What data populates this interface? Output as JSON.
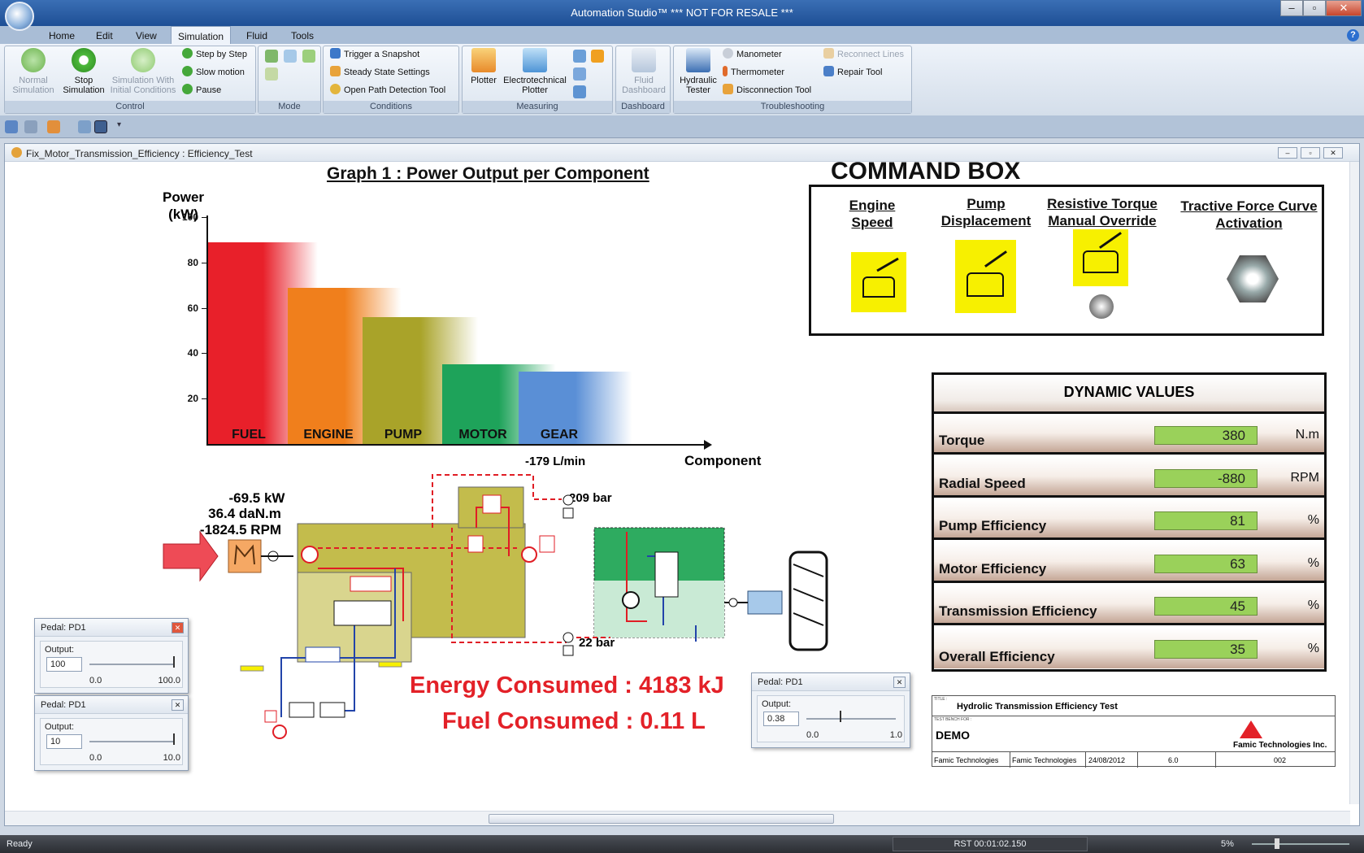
{
  "window": {
    "title": "Automation Studio™  *** NOT FOR RESALE ***"
  },
  "tabs": [
    {
      "label": "Home"
    },
    {
      "label": "Edit"
    },
    {
      "label": "View"
    },
    {
      "label": "Simulation"
    },
    {
      "label": "Fluid"
    },
    {
      "label": "Tools"
    }
  ],
  "ribbon": {
    "control": {
      "caption": "Control",
      "normal_sim": "Normal\nSimulation",
      "stop_sim": "Stop\nSimulation",
      "sim_initial": "Simulation With\nInitial Conditions",
      "step": "Step by Step",
      "slow": "Slow motion",
      "pause": "Pause"
    },
    "mode": {
      "caption": "Mode"
    },
    "conditions": {
      "caption": "Conditions",
      "snapshot": "Trigger a Snapshot",
      "steady": "Steady State Settings",
      "openpath": "Open Path Detection Tool"
    },
    "measuring": {
      "caption": "Measuring",
      "plotter": "Plotter",
      "electro": "Electrotechnical\nPlotter"
    },
    "dashboard": {
      "caption": "Dashboard",
      "fluid": "Fluid\nDashboard"
    },
    "troubleshooting": {
      "caption": "Troubleshooting",
      "hydraulic": "Hydraulic\nTester",
      "manometer": "Manometer",
      "thermometer": "Thermometer",
      "disconnection": "Disconnection Tool",
      "reconnect": "Reconnect Lines",
      "repair": "Repair Tool"
    }
  },
  "document": {
    "title": "Fix_Motor_Transmission_Efficiency : Efficiency_Test"
  },
  "chart_data": {
    "type": "bar",
    "title": "Graph 1 : Power Output per Component",
    "ylabel": "Power\n(kW)",
    "xlabel": "Component",
    "ylim": [
      0,
      100
    ],
    "yticks": [
      20,
      40,
      60,
      80,
      100
    ],
    "categories": [
      "FUEL",
      "ENGINE",
      "PUMP",
      "MOTOR",
      "GEAR"
    ],
    "values": [
      89,
      69,
      56,
      35,
      32
    ],
    "colors": [
      "#e8202a",
      "#f07f1c",
      "#a9a329",
      "#1ea35a",
      "#5a8fd6"
    ]
  },
  "command_box": {
    "title": "COMMAND BOX",
    "engine_speed": "Engine\nSpeed",
    "pump_displacement": "Pump\nDisplacement",
    "resistive_torque": "Resistive Torque\nManual Override",
    "tractive_force": "Tractive Force Curve\nActivation"
  },
  "dynamic_values": {
    "title": "DYNAMIC VALUES",
    "rows": [
      {
        "label": "Torque",
        "value": "380",
        "unit": "N.m"
      },
      {
        "label": "Radial Speed",
        "value": "-880",
        "unit": "RPM"
      },
      {
        "label": "Pump Efficiency",
        "value": "81",
        "unit": "%"
      },
      {
        "label": "Motor Efficiency",
        "value": "63",
        "unit": "%"
      },
      {
        "label": "Transmission Efficiency",
        "value": "45",
        "unit": "%"
      },
      {
        "label": "Overall Efficiency",
        "value": "35",
        "unit": "%"
      }
    ]
  },
  "circuit": {
    "flow": "-179 L/min",
    "pressure_high": "209 bar",
    "pressure_low": "22 bar",
    "engine_power": "-69.5 kW",
    "engine_torque": "36.4 daN.m",
    "engine_speed": "-1824.5 RPM"
  },
  "totals": {
    "energy": "Energy Consumed : 4183 kJ",
    "fuel": "Fuel Consumed : 0.11 L"
  },
  "pedals": [
    {
      "title": "Pedal: PD1",
      "output_label": "Output:",
      "value": "100",
      "min": "0.0",
      "max": "100.0",
      "level": 1.0
    },
    {
      "title": "Pedal: PD1",
      "output_label": "Output:",
      "value": "10",
      "min": "0.0",
      "max": "10.0",
      "level": 1.0
    },
    {
      "title": "Pedal: PD1",
      "output_label": "Output:",
      "value": "0.38",
      "min": "0.0",
      "max": "1.0",
      "level": 0.38
    }
  ],
  "title_block": {
    "title_caption": "TITLE :",
    "title": "Hydrolic Transmission Efficiency Test",
    "bench_caption": "TEST BENCH FOR :",
    "bench": "DEMO",
    "company": "Famic Technologies Inc.",
    "drawn_by": "Famic Technologies",
    "verified_by": "Famic Technologies",
    "date": "24/08/2012",
    "version": "6.0",
    "catalog": "002"
  },
  "status": {
    "ready": "Ready",
    "time": "RST 00:01:02.150",
    "zoom": "5%"
  },
  "colors": {
    "accent": "#e32128",
    "value_green": "#9ad15a",
    "yellow": "#f7f000"
  }
}
